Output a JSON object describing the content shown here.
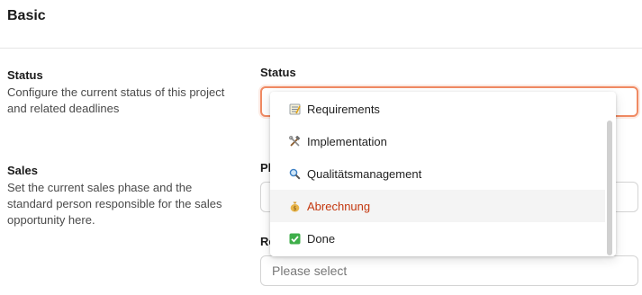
{
  "section": {
    "title": "Basic"
  },
  "groups": {
    "status": {
      "title": "Status",
      "description": "Configure the current status of this project and related deadlines"
    },
    "sales": {
      "title": "Sales",
      "description": "Set the current sales phase and the standard person responsible for the sales opportunity here."
    }
  },
  "fields": {
    "status": {
      "label": "Status",
      "value": ""
    },
    "phase": {
      "label": "Ph"
    },
    "responsible": {
      "label": "Re",
      "placeholder": "Please select"
    }
  },
  "dropdown": {
    "highlighted_index": 3,
    "accent_color": "#c4380f",
    "options": [
      {
        "label": "Requirements",
        "icon": "memo-icon"
      },
      {
        "label": "Implementation",
        "icon": "hammer-wrench-icon"
      },
      {
        "label": "Qualitätsmanagement",
        "icon": "magnifier-icon"
      },
      {
        "label": "Abrechnung",
        "icon": "money-bag-icon"
      },
      {
        "label": "Done",
        "icon": "check-box-icon"
      }
    ]
  }
}
